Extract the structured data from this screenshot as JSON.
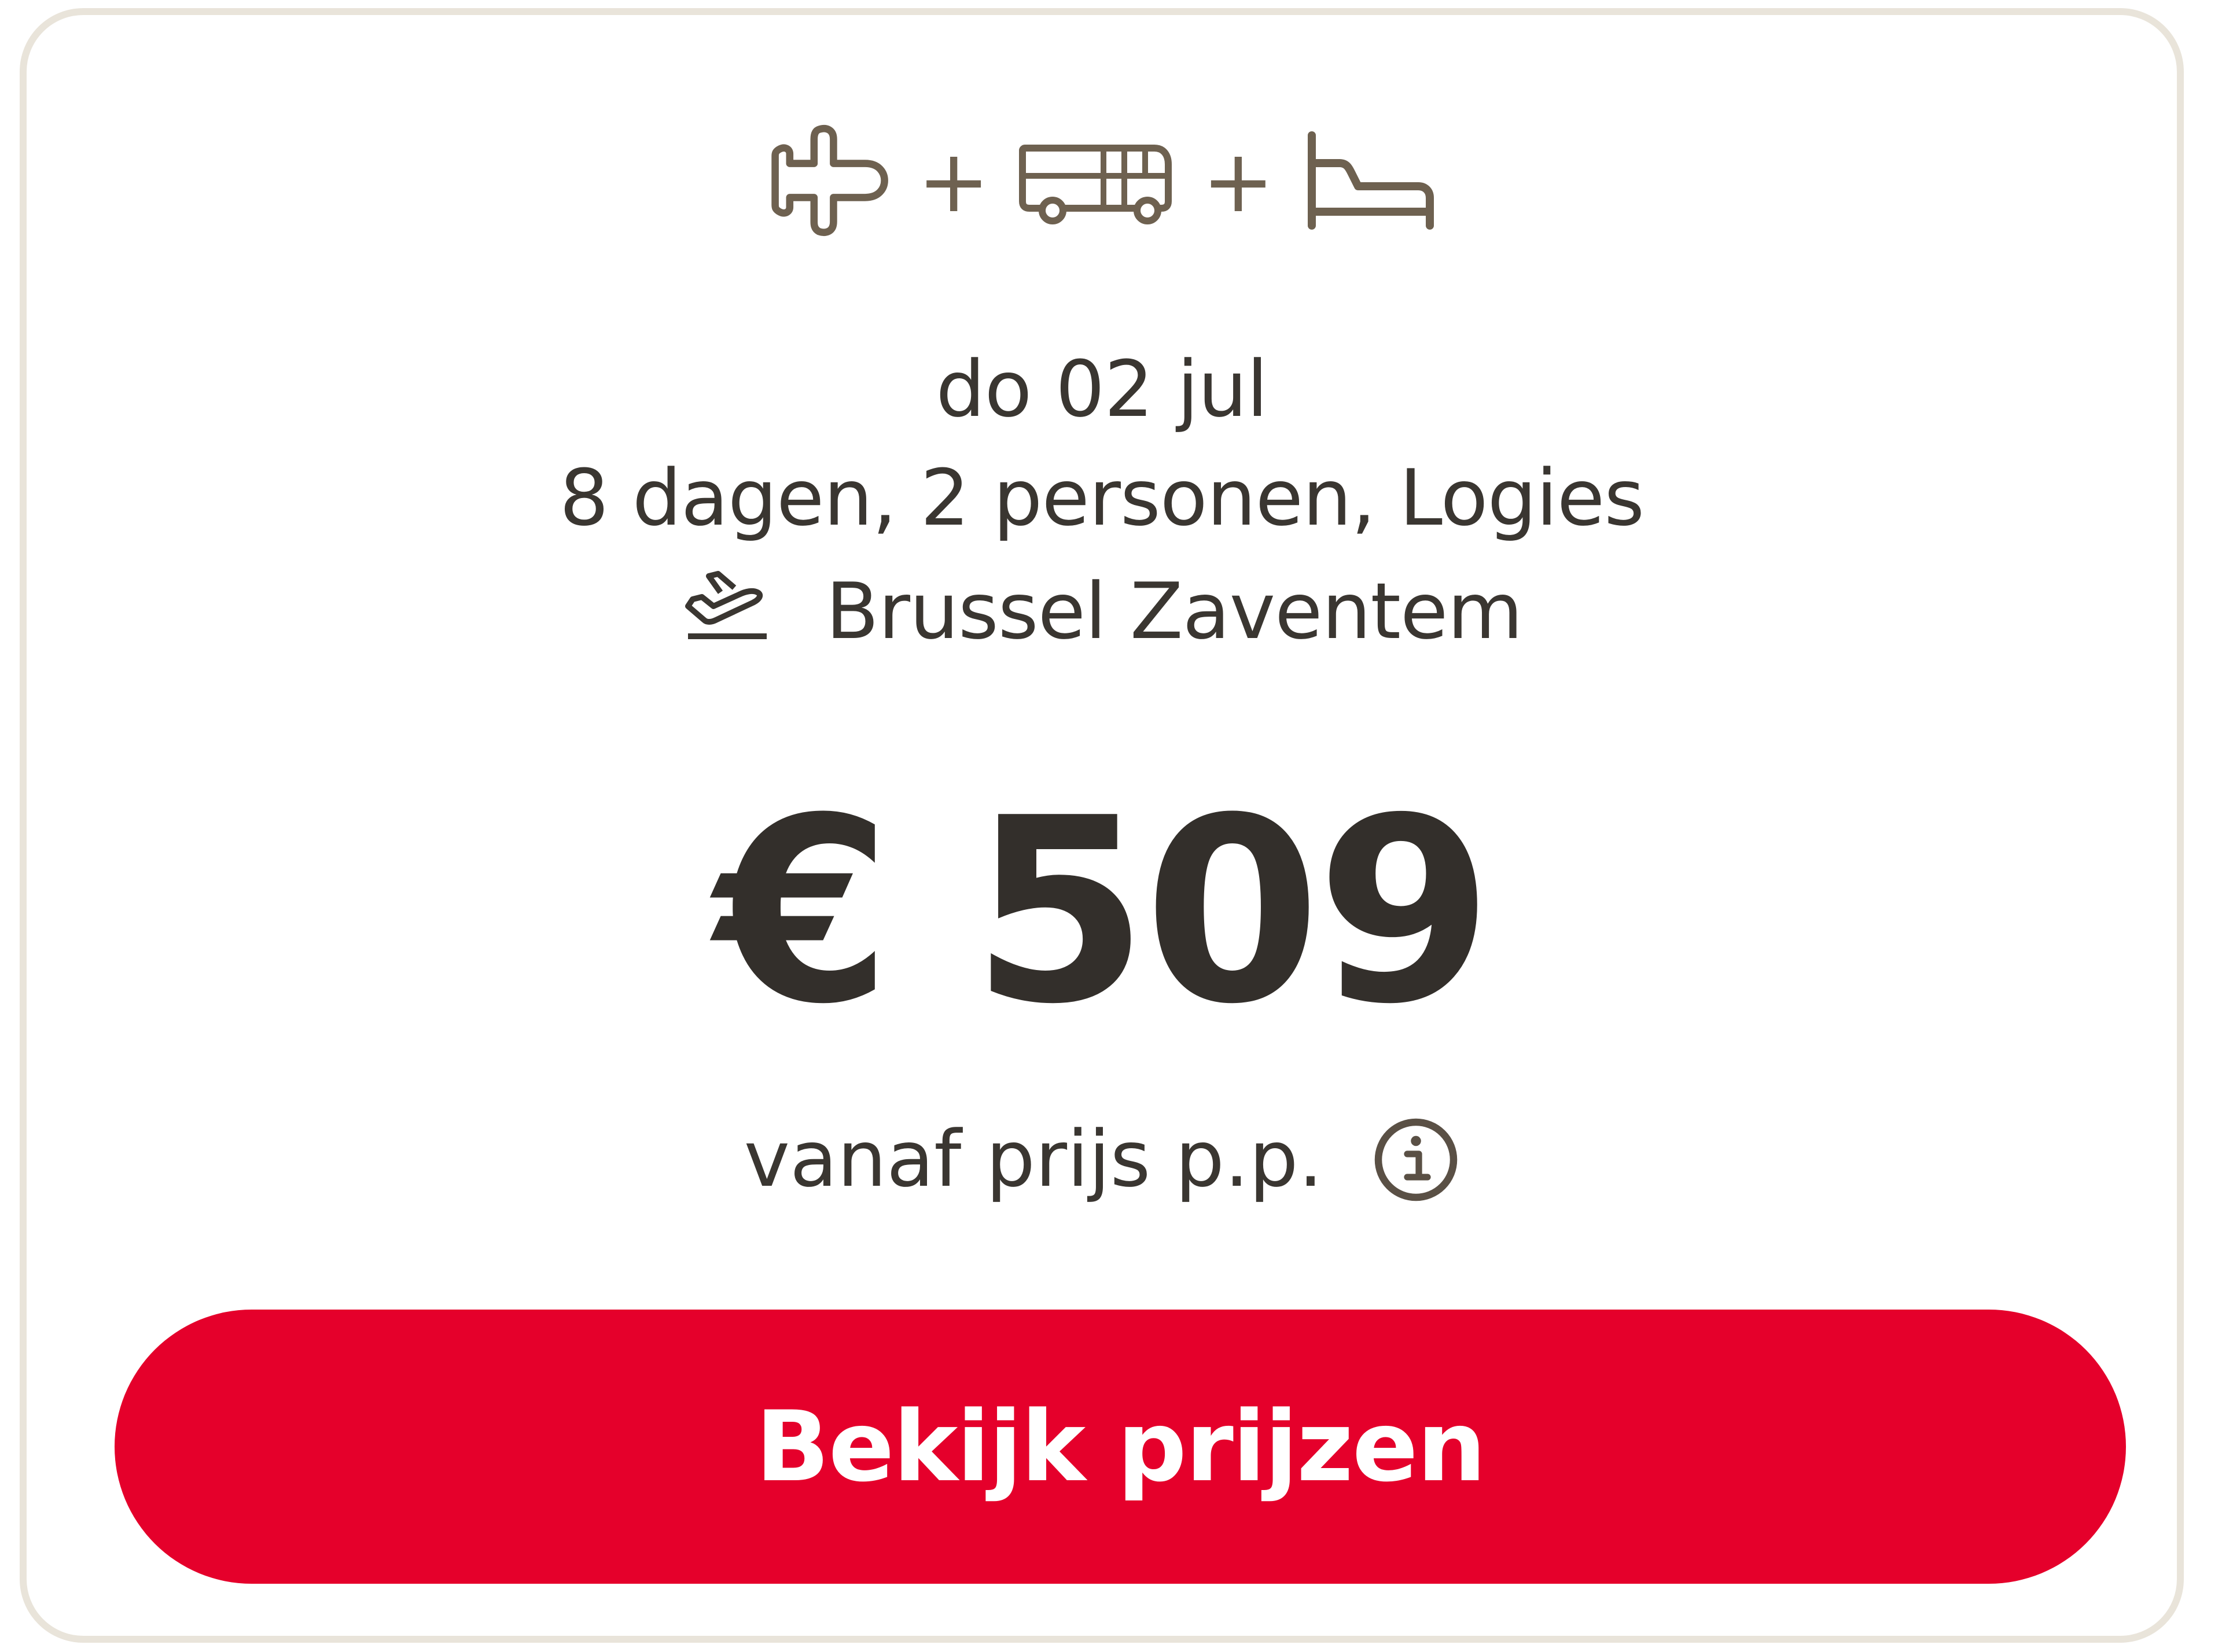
{
  "package": {
    "components": [
      "plane-icon",
      "bus-icon",
      "bed-icon"
    ],
    "separator": "+"
  },
  "trip": {
    "date": "do 02 jul",
    "details": "8 dagen, 2 personen, Logies",
    "departure_airport": "Brussel Zaventem"
  },
  "price": {
    "amount": "€ 509",
    "label": "vanaf prijs p.p."
  },
  "cta": {
    "label": "Bekijk prijzen"
  },
  "colors": {
    "cta_background": "#e5002b",
    "icon": "#6e6150",
    "text": "#3a3631",
    "card_border": "#e9e4da"
  }
}
